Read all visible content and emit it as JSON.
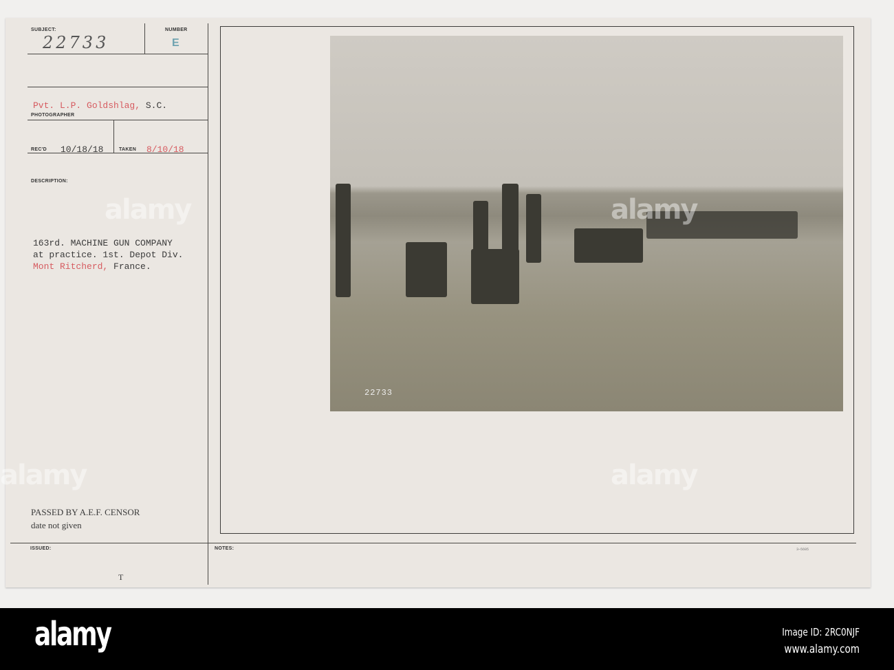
{
  "card": {
    "subject_label": "SUBJECT:",
    "subject_value": "22733",
    "number_label": "NUMBER",
    "number_value": "E",
    "photographer_name": "Pvt. L.P. Goldshlag,",
    "photographer_unit": "S.C.",
    "photographer_label": "PHOTOGRAPHER",
    "recd_label": "REC'D",
    "recd_value": "10/18/18",
    "taken_label": "TAKEN",
    "taken_value": "8/10/18",
    "description_label": "DESCRIPTION:",
    "description_lines": [
      "163rd. MACHINE GUN COMPANY",
      "at practice. 1st. Depot Div."
    ],
    "description_place": "Mont Ritcherd,",
    "description_country": "France.",
    "censor_line1": "PASSED BY A.E.F. CENSOR",
    "censor_line2": "date not given",
    "issued_label": "ISSUED:",
    "notes_label": "NOTES:",
    "form_number": "3—5605",
    "issued_mark": "T"
  },
  "photo": {
    "stamp_number": "22733"
  },
  "watermark": "alamy",
  "footer": {
    "logo": "alamy",
    "image_id": "Image ID: 2RC0NJF",
    "url": "www.alamy.com"
  }
}
